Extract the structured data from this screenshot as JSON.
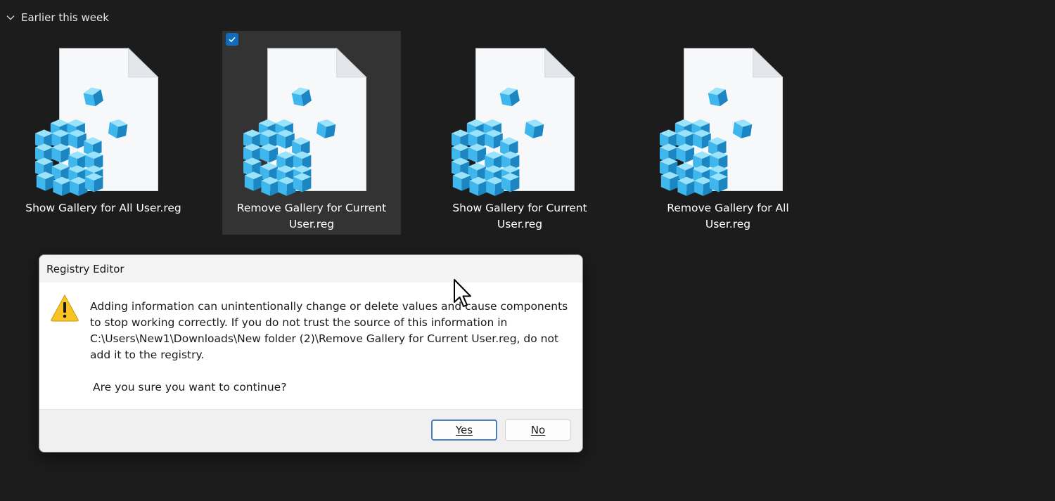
{
  "group": {
    "label": "Earlier this week"
  },
  "files": [
    {
      "name": "Show Gallery for All User.reg",
      "selected": false
    },
    {
      "name": "Remove Gallery for Current User.reg",
      "selected": true
    },
    {
      "name": "Show Gallery for Current User.reg",
      "selected": false
    },
    {
      "name": "Remove Gallery for All User.reg",
      "selected": false
    }
  ],
  "dialog": {
    "title": "Registry Editor",
    "message": "Adding information can unintentionally change or delete values and cause components to stop working correctly. If you do not trust the source of this information in C:\\Users\\New1\\Downloads\\New folder (2)\\Remove Gallery for Current User.reg, do not add it to the registry.",
    "question": "Are you sure you want to continue?",
    "yes_label": "Yes",
    "no_label": "No"
  },
  "colors": {
    "background": "#1c1c1c",
    "selection": "#333333",
    "checkbox": "#0f6cbd",
    "cube_light": "#5fc8f3",
    "cube_dark": "#1f8fc9",
    "warning": "#f7c325"
  }
}
